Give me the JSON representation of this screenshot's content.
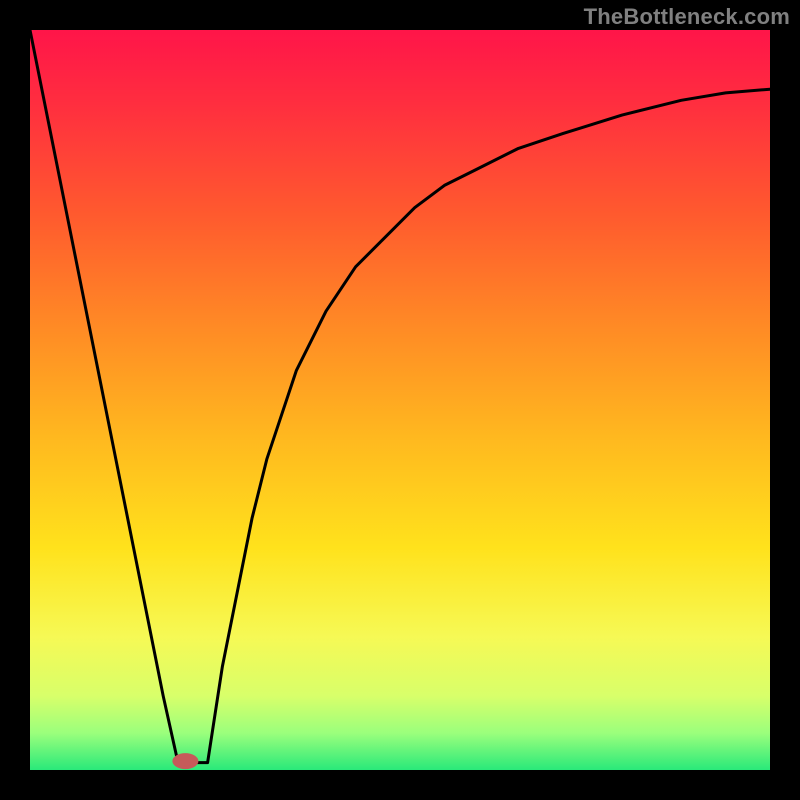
{
  "watermark": "TheBottleneck.com",
  "chart_data": {
    "type": "line",
    "title": "",
    "xlabel": "",
    "ylabel": "",
    "xlim": [
      0,
      100
    ],
    "ylim": [
      0,
      100
    ],
    "grid": false,
    "series": [
      {
        "name": "curve",
        "x": [
          0,
          2,
          4,
          6,
          8,
          10,
          12,
          14,
          16,
          18,
          20,
          22,
          24,
          26,
          28,
          30,
          32,
          34,
          36,
          38,
          40,
          44,
          48,
          52,
          56,
          60,
          66,
          72,
          80,
          88,
          94,
          100
        ],
        "values": [
          100,
          90,
          80,
          70,
          60,
          50,
          40,
          30,
          20,
          10,
          1,
          1,
          1,
          14,
          24,
          34,
          42,
          48,
          54,
          58,
          62,
          68,
          72,
          76,
          79,
          81,
          84,
          86,
          88.5,
          90.5,
          91.5,
          92
        ]
      }
    ],
    "marker": {
      "x": 21,
      "y": 1.2
    },
    "gradient_stops": [
      {
        "offset": 0.0,
        "color": "#ff1549"
      },
      {
        "offset": 0.1,
        "color": "#ff2e3f"
      },
      {
        "offset": 0.25,
        "color": "#ff5a2e"
      },
      {
        "offset": 0.4,
        "color": "#ff8a25"
      },
      {
        "offset": 0.55,
        "color": "#ffb81f"
      },
      {
        "offset": 0.7,
        "color": "#ffe21c"
      },
      {
        "offset": 0.82,
        "color": "#f6f955"
      },
      {
        "offset": 0.9,
        "color": "#d8ff6a"
      },
      {
        "offset": 0.95,
        "color": "#9bff7c"
      },
      {
        "offset": 1.0,
        "color": "#29e97a"
      }
    ]
  }
}
